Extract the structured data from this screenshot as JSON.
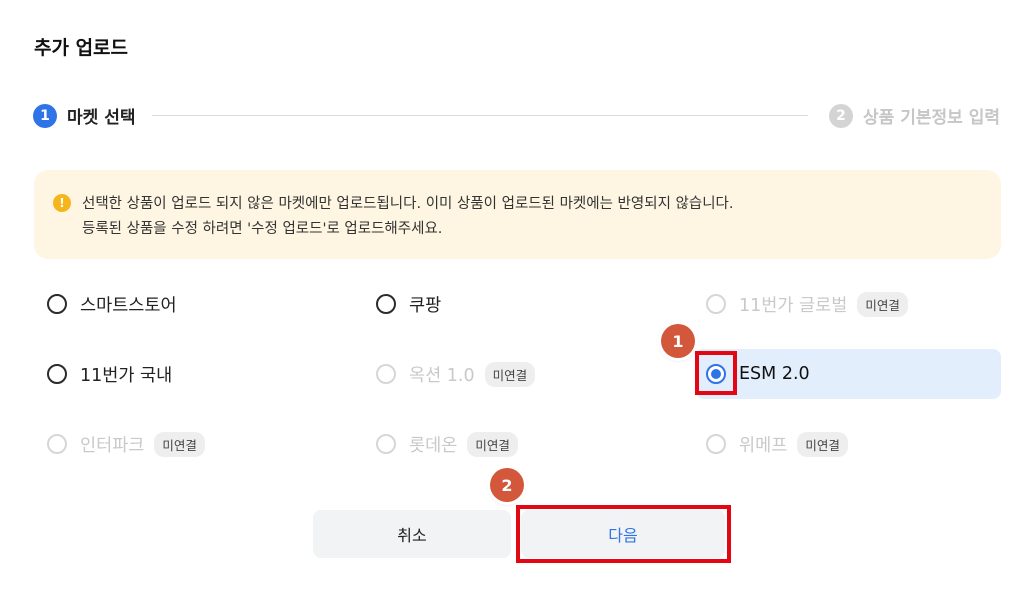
{
  "dialog": {
    "title": "추가 업로드"
  },
  "steps": [
    {
      "number": "1",
      "label": "마켓 선택"
    },
    {
      "number": "2",
      "label": "상품 기본정보 입력"
    }
  ],
  "notice": {
    "icon": "warning-icon",
    "line1": "선택한 상품이 업로드 되지 않은 마켓에만 업로드됩니다. 이미 상품이 업로드된 마켓에는 반영되지 않습니다.",
    "line2": "등록된 상품을 수정 하려면 '수정 업로드'로 업로드해주세요."
  },
  "markets": [
    {
      "label": "스마트스토어",
      "badge": "",
      "disabled": false,
      "selected": false
    },
    {
      "label": "쿠팡",
      "badge": "",
      "disabled": false,
      "selected": false
    },
    {
      "label": "11번가 글로벌",
      "badge": "미연결",
      "disabled": true,
      "selected": false
    },
    {
      "label": "11번가 국내",
      "badge": "",
      "disabled": false,
      "selected": false
    },
    {
      "label": "옥션 1.0",
      "badge": "미연결",
      "disabled": true,
      "selected": false
    },
    {
      "label": "ESM 2.0",
      "badge": "",
      "disabled": false,
      "selected": true
    },
    {
      "label": "인터파크",
      "badge": "미연결",
      "disabled": true,
      "selected": false
    },
    {
      "label": "롯데온",
      "badge": "미연결",
      "disabled": true,
      "selected": false
    },
    {
      "label": "위메프",
      "badge": "미연결",
      "disabled": true,
      "selected": false
    }
  ],
  "annotations": {
    "marker1": "1",
    "marker2": "2"
  },
  "buttons": {
    "cancel": "취소",
    "next": "다음"
  },
  "colors": {
    "accent": "#2f74e6",
    "highlight": "#e30613",
    "marker": "#d2573b",
    "notice_bg": "#fef6e2"
  }
}
